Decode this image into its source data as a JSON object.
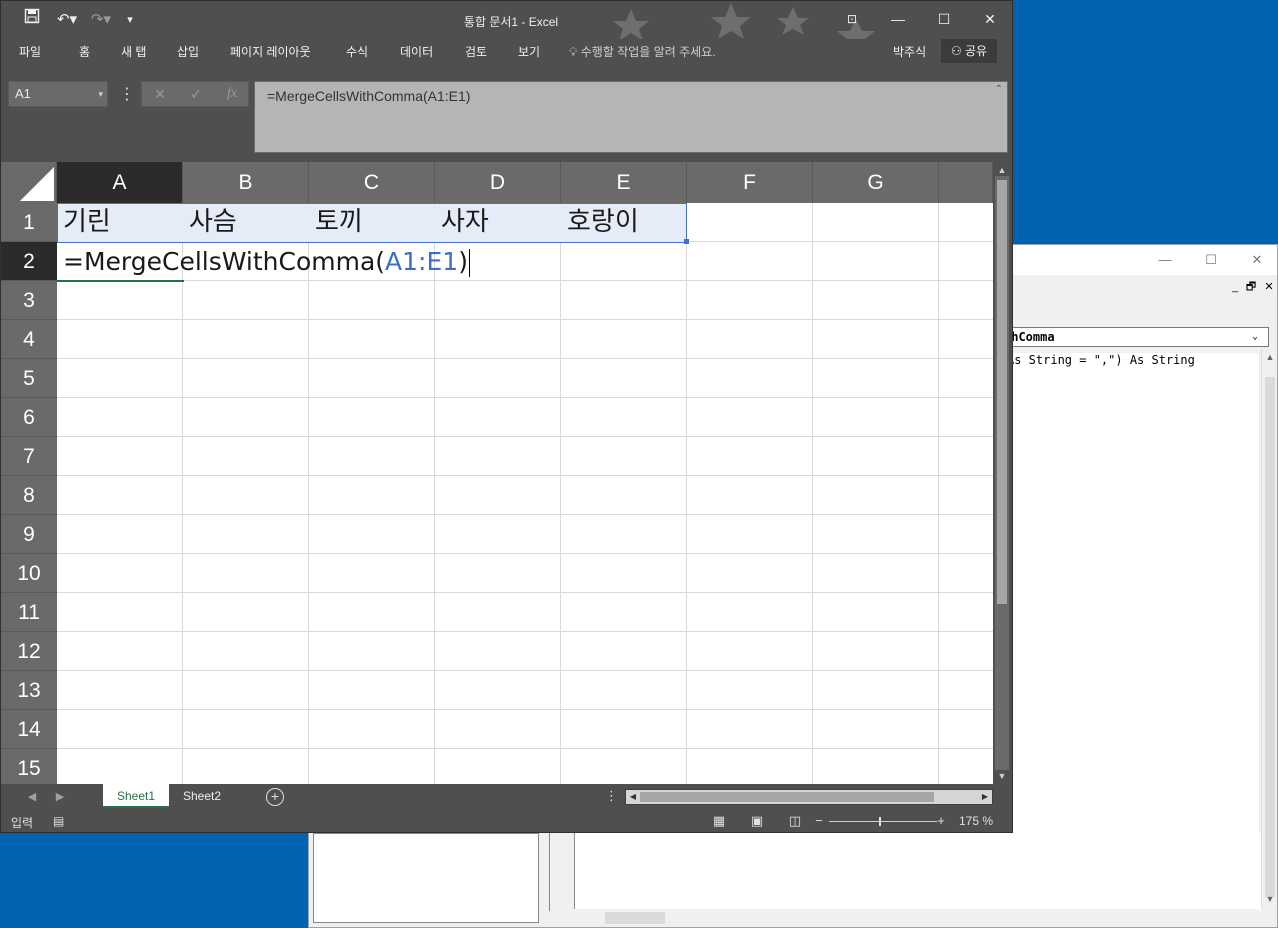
{
  "excel": {
    "title": "통합 문서1 - Excel",
    "ribbon_tabs": [
      "파일",
      "홈",
      "새 탭",
      "삽입",
      "페이지 레이아웃",
      "수식",
      "데이터",
      "검토",
      "보기"
    ],
    "tell_me": "수행할 작업을 알려 주세요.",
    "user": "박주식",
    "share": "공유",
    "name_box": "A1",
    "formula": "=MergeCellsWithComma(A1:E1)",
    "columns": [
      "A",
      "B",
      "C",
      "D",
      "E",
      "F",
      "G"
    ],
    "rows": [
      "1",
      "2",
      "3",
      "4",
      "5",
      "6",
      "7",
      "8",
      "9",
      "10",
      "11",
      "12",
      "13",
      "14",
      "15"
    ],
    "row1_values": [
      "기린",
      "사슴",
      "토끼",
      "사자",
      "호랑이"
    ],
    "editing": {
      "prefix": "=MergeCellsWithComma(",
      "ref": "A1:E1",
      "suffix": ")"
    },
    "sheets": [
      "Sheet1",
      "Sheet2"
    ],
    "status_mode": "입력",
    "zoom": "175 %"
  },
  "vbe": {
    "proc_combo": "thComma",
    "code_line": "As String = \",\") As String"
  },
  "colors": {
    "accent": "#217346",
    "range": "#4472c4",
    "desktop": "#0063b1"
  }
}
